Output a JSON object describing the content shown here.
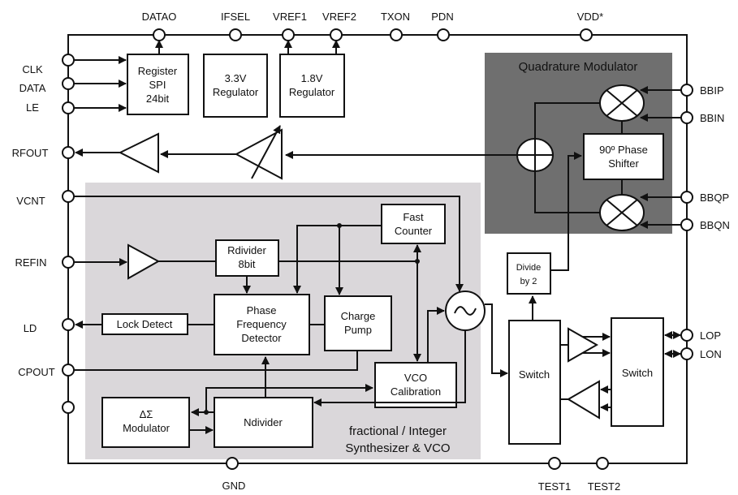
{
  "pins": {
    "top": [
      "DATAO",
      "IFSEL",
      "VREF1",
      "VREF2",
      "TXON",
      "PDN",
      "VDD*"
    ],
    "left": [
      "CLK",
      "DATA",
      "LE",
      "RFOUT",
      "VCNT",
      "REFIN",
      "LD",
      "CPOUT"
    ],
    "right": [
      "BBIP",
      "BBIN",
      "BBQP",
      "BBQN",
      "LOP",
      "LON"
    ],
    "bottom": [
      "GND",
      "TEST1",
      "TEST2"
    ]
  },
  "blocks": {
    "register": [
      "Register",
      "SPI",
      "24bit"
    ],
    "reg33": [
      "3.3V",
      "Regulator"
    ],
    "reg18": [
      "1.8V",
      "Regulator"
    ],
    "quad_title": "Quadrature  Modulator",
    "phase_shifter": [
      "90º Phase",
      "Shifter"
    ],
    "divide": [
      "Divide",
      "by 2"
    ],
    "fast_counter": [
      "Fast",
      "Counter"
    ],
    "rdivider": [
      "Rdivider",
      "8bit"
    ],
    "pfd": [
      "Phase",
      "Frequency",
      "Detector"
    ],
    "charge_pump": [
      "Charge",
      "Pump"
    ],
    "lock_detect": "Lock Detect",
    "vco_cal": [
      "VCO",
      "Calibration"
    ],
    "ds_mod": [
      "ΔΣ",
      "Modulator"
    ],
    "ndivider": "Ndivider",
    "switch1": "Switch",
    "switch2": "Switch",
    "synth_title": [
      "fractional / Integer",
      "Synthesizer & VCO"
    ]
  },
  "colors": {
    "quad_bg": "#6f6f6f",
    "synth_bg": "#dad7da"
  }
}
